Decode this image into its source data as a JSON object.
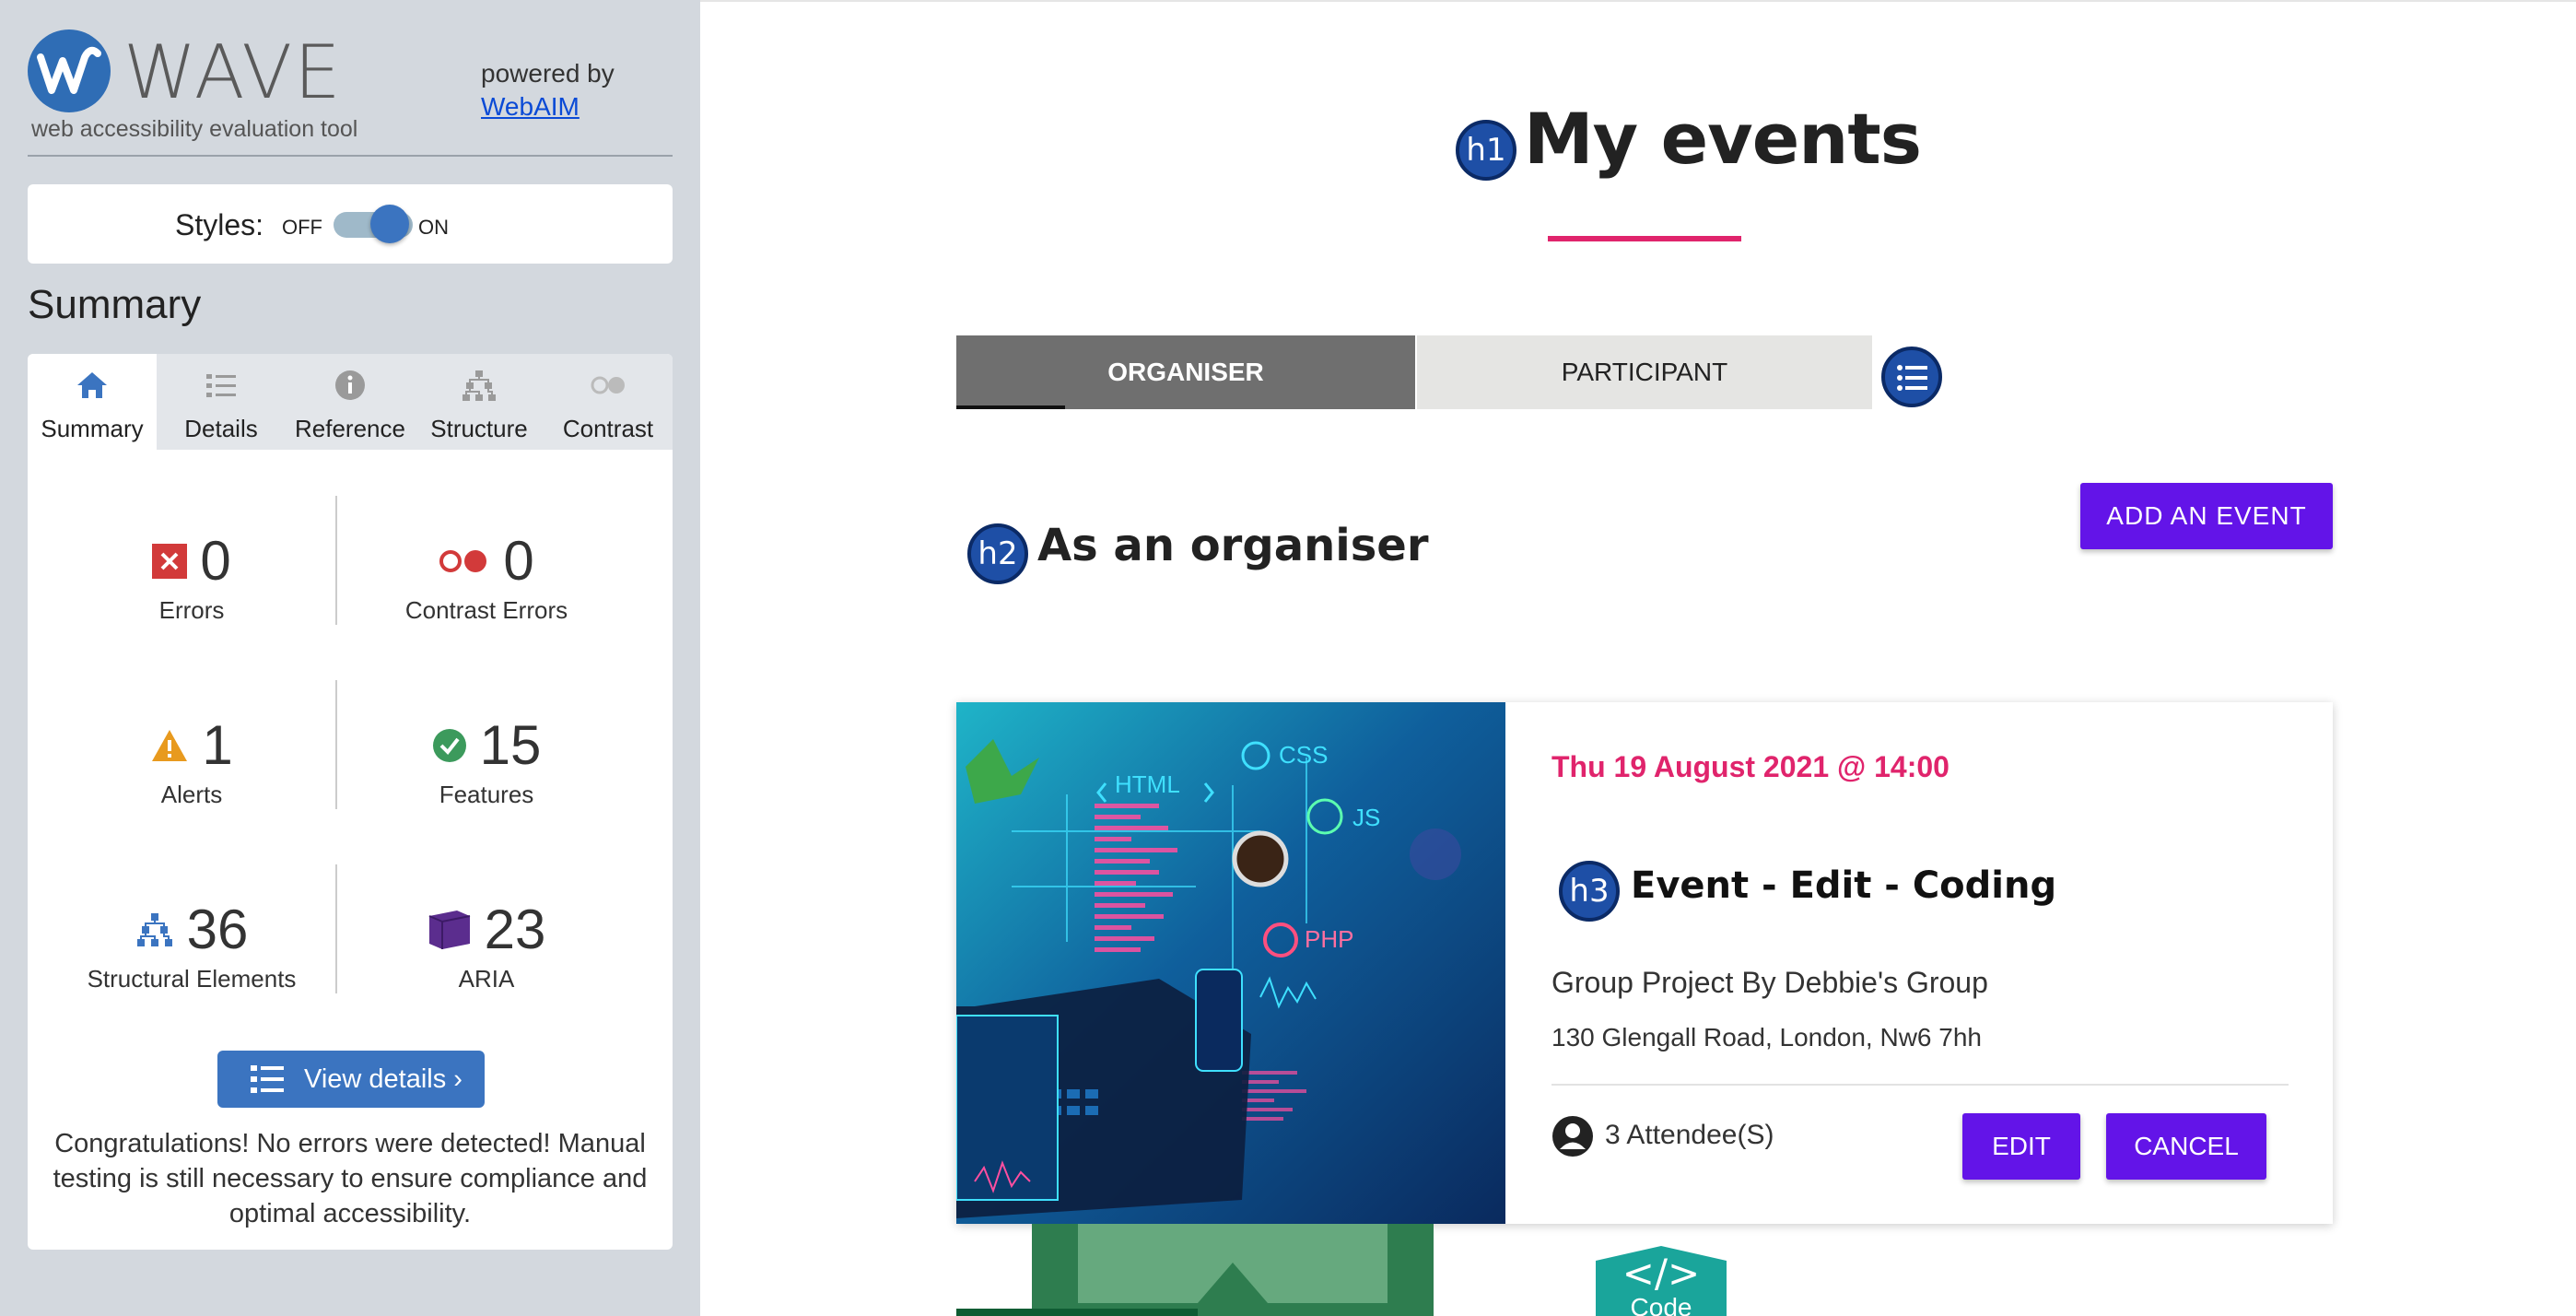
{
  "wave": {
    "name": "WAVE",
    "tagline": "web accessibility evaluation tool",
    "powered_by": "powered by",
    "powered_link": "WebAIM",
    "styles_label": "Styles:",
    "styles_off": "OFF",
    "styles_on": "ON",
    "summary_heading": "Summary",
    "tabs": [
      {
        "label": "Summary",
        "icon": "home-icon"
      },
      {
        "label": "Details",
        "icon": "list-icon"
      },
      {
        "label": "Reference",
        "icon": "info-icon"
      },
      {
        "label": "Structure",
        "icon": "hierarchy-icon"
      },
      {
        "label": "Contrast",
        "icon": "contrast-icon"
      }
    ],
    "stats": {
      "errors": {
        "count": "0",
        "label": "Errors"
      },
      "contrast_errors": {
        "count": "0",
        "label": "Contrast Errors"
      },
      "alerts": {
        "count": "1",
        "label": "Alerts"
      },
      "features": {
        "count": "15",
        "label": "Features"
      },
      "structural": {
        "count": "36",
        "label": "Structural Elements"
      },
      "aria": {
        "count": "23",
        "label": "ARIA"
      }
    },
    "view_details": "View details ›",
    "congrats": "Congratulations! No errors were detected! Manual testing is still necessary to ensure compliance and optimal accessibility."
  },
  "page": {
    "h1_badge": "h1",
    "title": "My events",
    "tab_organiser": "ORGANISER",
    "tab_participant": "PARTICIPANT",
    "h2_badge": "h2",
    "section_title": "As an organiser",
    "add_event": "ADD AN EVENT",
    "event": {
      "date": "Thu 19 August 2021 @ 14:00",
      "h3_badge": "h3",
      "title": "Event - Edit - Coding",
      "group": "Group Project By Debbie's Group",
      "address": "130 Glengall Road, London, Nw6 7hh",
      "attendees": "3 Attendee(S)",
      "edit": "EDIT",
      "cancel": "CANCEL",
      "image_labels": {
        "html": "HTML",
        "css": "CSS",
        "js": "JS",
        "php": "PHP"
      }
    },
    "code_badge": {
      "symbol": "</>",
      "label": "Code"
    }
  },
  "colors": {
    "wave_blue": "#3b74c0",
    "accent_pink": "#e0246c",
    "button_purple": "#6314e8",
    "badge_blue": "#1e4fa6"
  }
}
